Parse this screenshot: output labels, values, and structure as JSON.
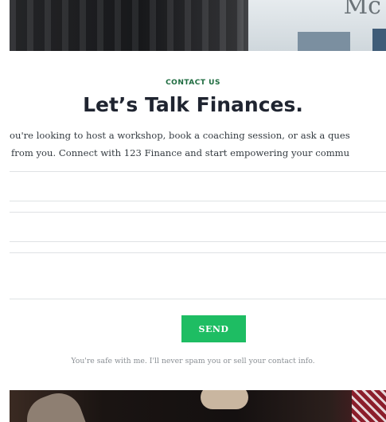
{
  "hero": {
    "screen_text": "Mc"
  },
  "contact": {
    "eyebrow": "CONTACT US",
    "heading": "Let’s Talk Finances.",
    "intro_line1": "ou're looking to host a workshop, book a coaching session, or ask a ques",
    "intro_line2": "from you. Connect with 123 Finance and start empowering your commu"
  },
  "form": {
    "send_label": "SEND",
    "privacy_note": "You're safe with me. I'll never spam you or sell your contact info."
  },
  "colors": {
    "eyebrow": "#1d6b3f",
    "heading": "#1f2430",
    "send_button": "#1ebd63",
    "field_border": "#dfe2e4"
  }
}
